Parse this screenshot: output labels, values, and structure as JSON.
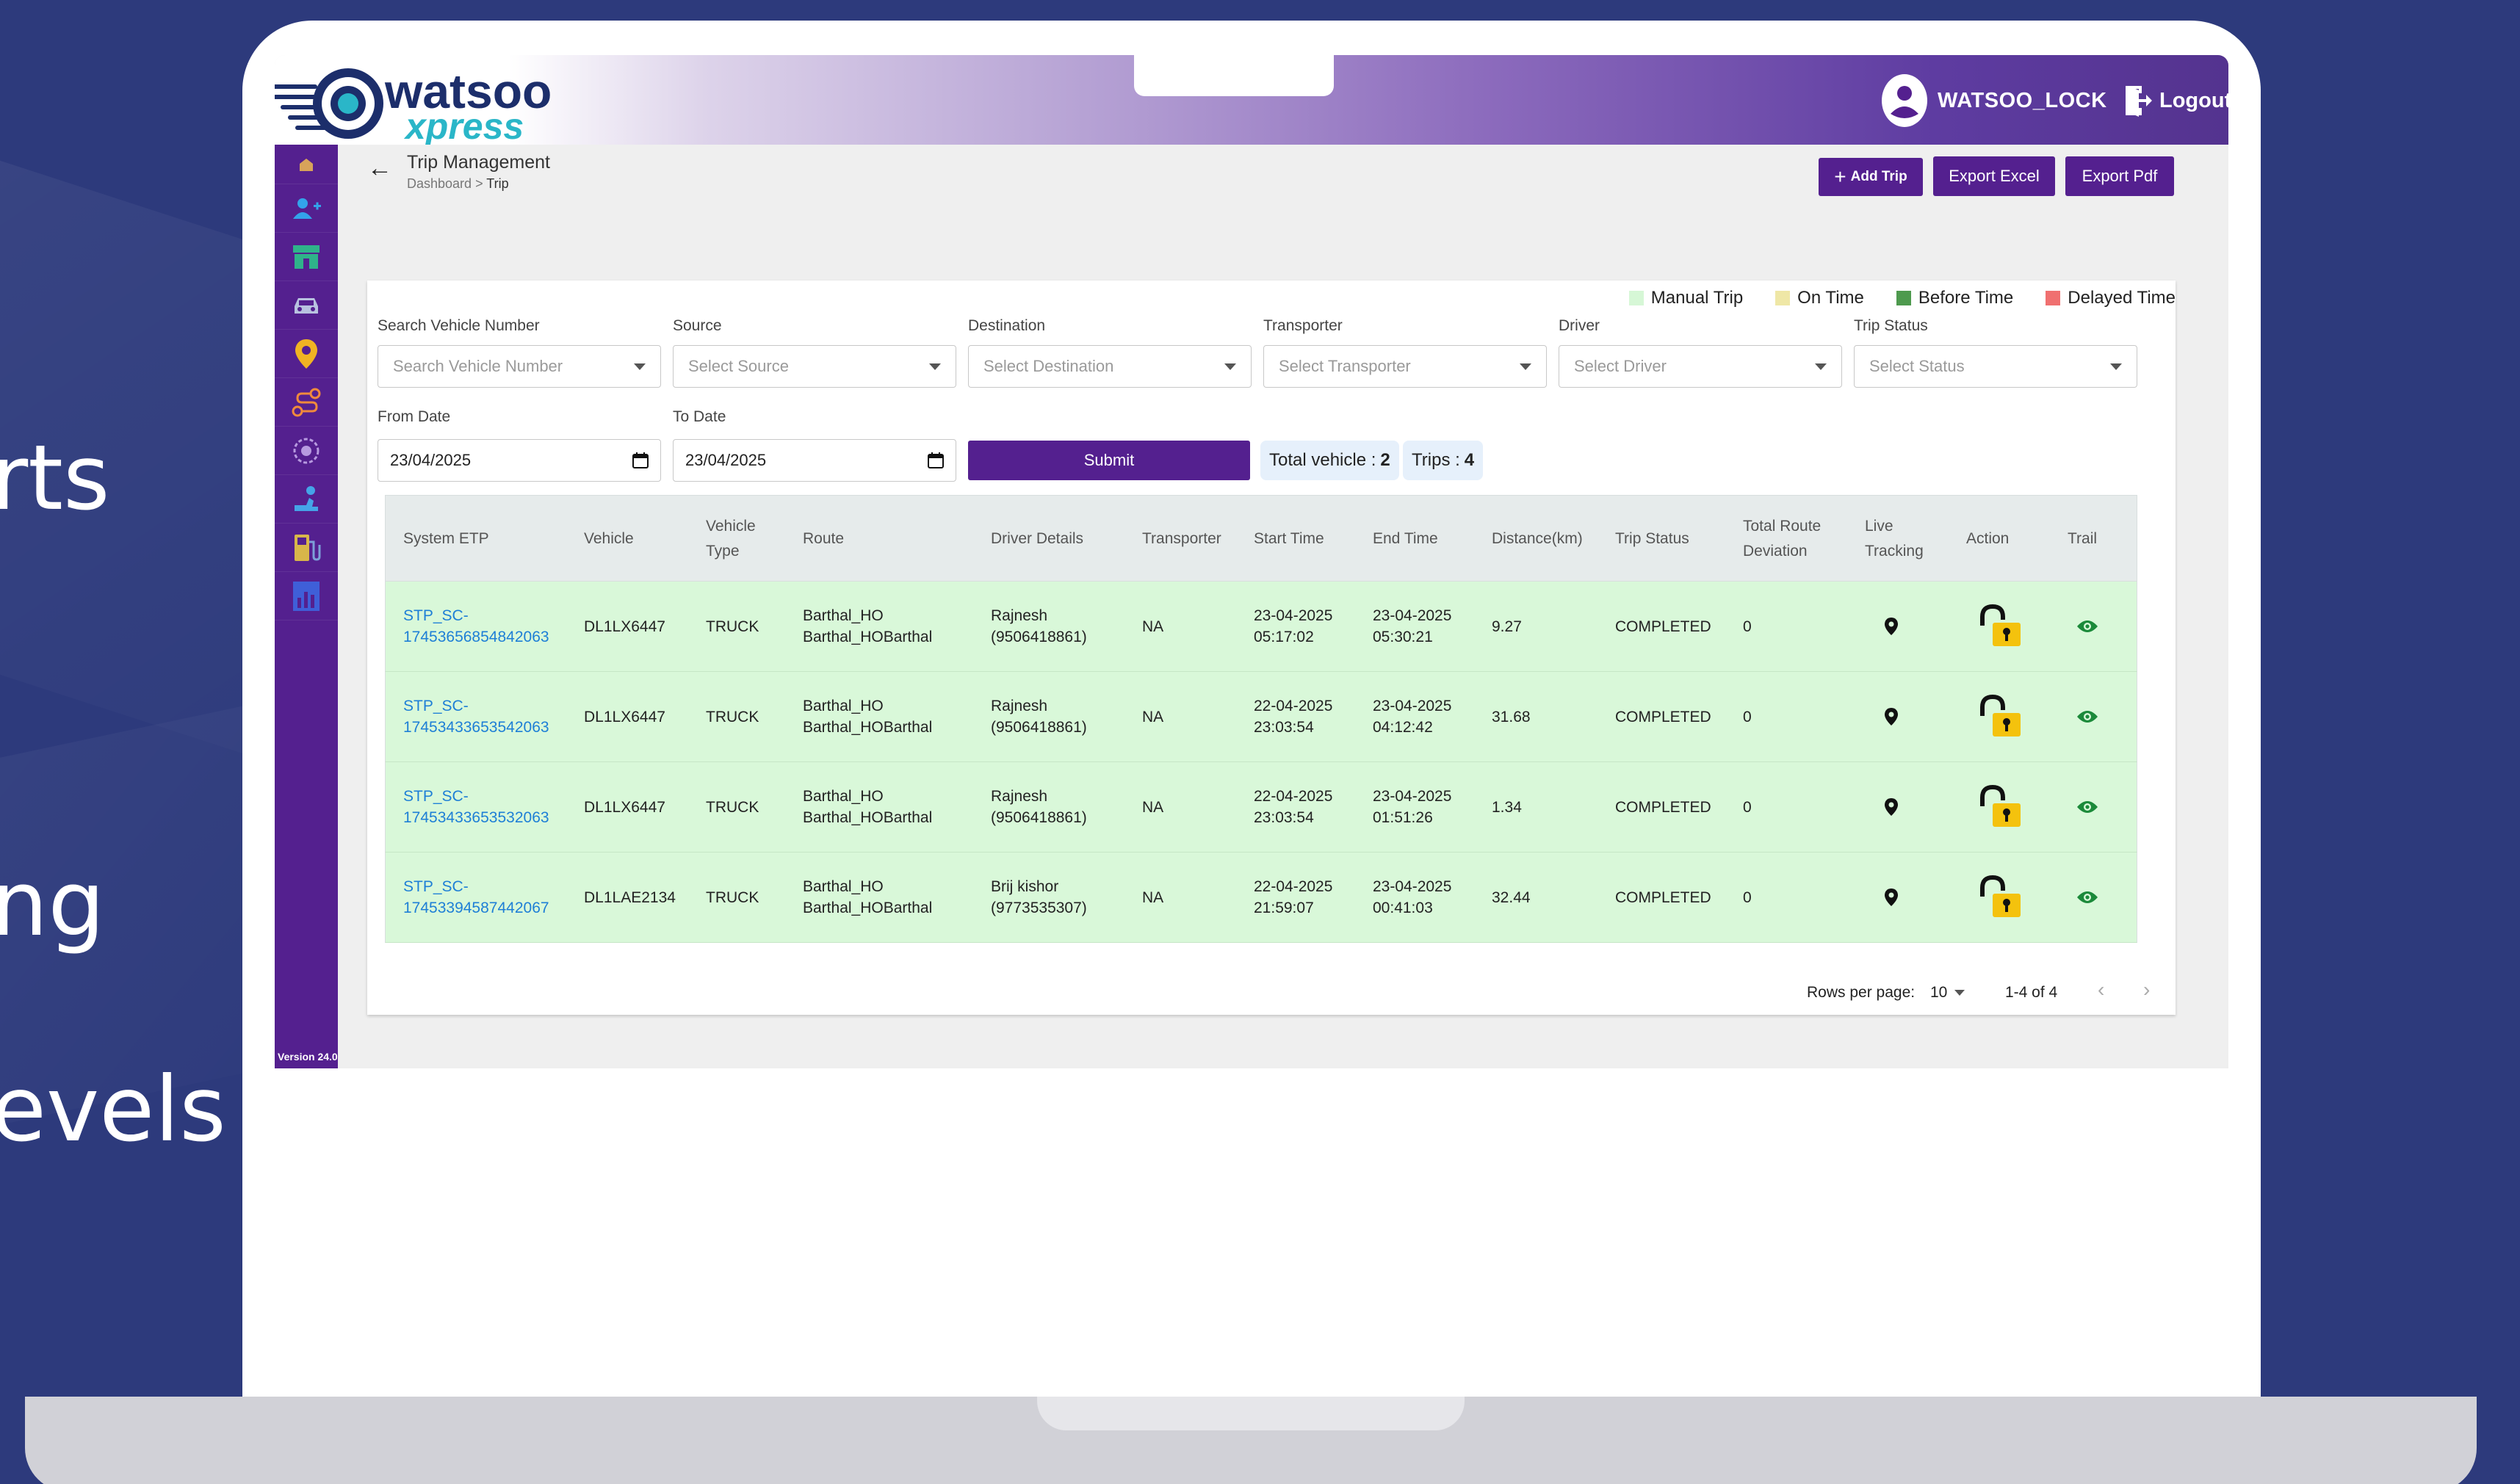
{
  "slide": {
    "fragments": [
      "rts",
      "ng",
      "evels"
    ]
  },
  "header": {
    "brand_top": "watsoo",
    "brand_bottom": "xpress",
    "username": "WATSOO_LOCK",
    "logout_label": "Logout"
  },
  "sidebar": {
    "version": "Version 24.0",
    "items": [
      "home-icon",
      "add-user-icon",
      "store-icon",
      "car-icon",
      "location-pin-icon",
      "route-icon",
      "geofence-icon",
      "driver-icon",
      "fuel-icon",
      "report-icon"
    ]
  },
  "page": {
    "title": "Trip Management",
    "breadcrumb_parent": "Dashboard",
    "breadcrumb_sep": " > ",
    "breadcrumb_current": "Trip",
    "add_trip_label": "Add Trip",
    "export_excel_label": "Export Excel",
    "export_pdf_label": "Export Pdf"
  },
  "legend": [
    {
      "label": "Manual Trip",
      "color": "#d6f7d6"
    },
    {
      "label": "On Time",
      "color": "#efe7a6"
    },
    {
      "label": "Before Time",
      "color": "#4e9a4e"
    },
    {
      "label": "Delayed Time",
      "color": "#f07070"
    }
  ],
  "filters": {
    "vehicle": {
      "label": "Search Vehicle Number",
      "placeholder": "Search Vehicle Number"
    },
    "source": {
      "label": "Source",
      "placeholder": "Select Source"
    },
    "destination": {
      "label": "Destination",
      "placeholder": "Select Destination"
    },
    "transporter": {
      "label": "Transporter",
      "placeholder": "Select Transporter"
    },
    "driver": {
      "label": "Driver",
      "placeholder": "Select Driver"
    },
    "status": {
      "label": "Trip Status",
      "placeholder": "Select Status"
    },
    "from_date": {
      "label": "From Date",
      "value": "23/04/2025"
    },
    "to_date": {
      "label": "To Date",
      "value": "23/04/2025"
    },
    "submit_label": "Submit",
    "total_vehicle_label": "Total vehicle :",
    "total_vehicle_value": "2",
    "trips_label": "Trips :",
    "trips_value": "4"
  },
  "table": {
    "columns": [
      "System ETP",
      "Vehicle",
      "Vehicle Type",
      "Route",
      "Driver Details",
      "Transporter",
      "Start Time",
      "End Time",
      "Distance(km)",
      "Trip Status",
      "Total Route Deviation",
      "Live Tracking",
      "Action",
      "Trail"
    ],
    "column_lines": {
      "vehicle_type": [
        "Vehicle",
        "Type"
      ],
      "total_route_deviation": [
        "Total Route",
        "Deviation"
      ],
      "live_tracking": [
        "Live",
        "Tracking"
      ]
    },
    "rows": [
      {
        "etp": [
          "STP_SC-",
          "17453656854842063"
        ],
        "vehicle": "DL1LX6447",
        "type": "TRUCK",
        "route": [
          "Barthal_HO",
          "Barthal_HOBarthal"
        ],
        "driver": [
          "Rajnesh",
          "(9506418861)"
        ],
        "transporter": "NA",
        "start": [
          "23-04-2025",
          "05:17:02"
        ],
        "end": [
          "23-04-2025",
          "05:30:21"
        ],
        "distance": "9.27",
        "status": "COMPLETED",
        "deviation": "0"
      },
      {
        "etp": [
          "STP_SC-",
          "17453433653542063"
        ],
        "vehicle": "DL1LX6447",
        "type": "TRUCK",
        "route": [
          "Barthal_HO",
          "Barthal_HOBarthal"
        ],
        "driver": [
          "Rajnesh",
          "(9506418861)"
        ],
        "transporter": "NA",
        "start": [
          "22-04-2025",
          "23:03:54"
        ],
        "end": [
          "23-04-2025",
          "04:12:42"
        ],
        "distance": "31.68",
        "status": "COMPLETED",
        "deviation": "0"
      },
      {
        "etp": [
          "STP_SC-",
          "17453433653532063"
        ],
        "vehicle": "DL1LX6447",
        "type": "TRUCK",
        "route": [
          "Barthal_HO",
          "Barthal_HOBarthal"
        ],
        "driver": [
          "Rajnesh",
          "(9506418861)"
        ],
        "transporter": "NA",
        "start": [
          "22-04-2025",
          "23:03:54"
        ],
        "end": [
          "23-04-2025",
          "01:51:26"
        ],
        "distance": "1.34",
        "status": "COMPLETED",
        "deviation": "0"
      },
      {
        "etp": [
          "STP_SC-",
          "17453394587442067"
        ],
        "vehicle": "DL1LAE2134",
        "type": "TRUCK",
        "route": [
          "Barthal_HO",
          "Barthal_HOBarthal"
        ],
        "driver": [
          "Brij kishor",
          "(9773535307)"
        ],
        "transporter": "NA",
        "start": [
          "22-04-2025",
          "21:59:07"
        ],
        "end": [
          "23-04-2025",
          "00:41:03"
        ],
        "distance": "32.44",
        "status": "COMPLETED",
        "deviation": "0"
      }
    ]
  },
  "pagination": {
    "rows_per_page_label": "Rows per page:",
    "rows_per_page_value": "10",
    "range_text": "1-4 of 4"
  },
  "colors": {
    "brand_purple": "#54208f",
    "row_green": "#d9f8d9",
    "link_blue": "#1e7fd6",
    "lock_yellow": "#f4c20d",
    "trail_green": "#1b8a3a"
  }
}
